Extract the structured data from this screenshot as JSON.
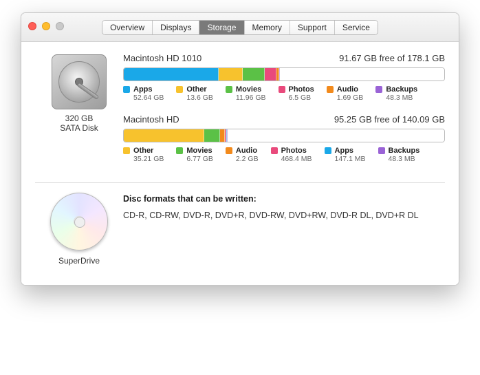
{
  "tabs": {
    "overview": "Overview",
    "displays": "Displays",
    "storage": "Storage",
    "memory": "Memory",
    "support": "Support",
    "service": "Service"
  },
  "drive": {
    "size_label": "320 GB",
    "type_label": "SATA Disk"
  },
  "colors": {
    "apps": "#1aa8e8",
    "other": "#f7c22d",
    "movies": "#5bc146",
    "photos": "#e94a7c",
    "audio": "#f28a1c",
    "backups": "#9a63d6",
    "free": "#ffffff"
  },
  "volumes": [
    {
      "name": "Macintosh HD 1010",
      "free_text": "91.67 GB free of 178.1 GB",
      "total_gb": 178.1,
      "segments": [
        {
          "key": "apps",
          "label": "Apps",
          "value": "52.64 GB",
          "gb": 52.64
        },
        {
          "key": "other",
          "label": "Other",
          "value": "13.6 GB",
          "gb": 13.6
        },
        {
          "key": "movies",
          "label": "Movies",
          "value": "11.96 GB",
          "gb": 11.96
        },
        {
          "key": "photos",
          "label": "Photos",
          "value": "6.5 GB",
          "gb": 6.5
        },
        {
          "key": "audio",
          "label": "Audio",
          "value": "1.69 GB",
          "gb": 1.69
        },
        {
          "key": "backups",
          "label": "Backups",
          "value": "48.3 MB",
          "gb": 0.05
        }
      ]
    },
    {
      "name": "Macintosh HD",
      "free_text": "95.25 GB free of 140.09 GB",
      "total_gb": 140.09,
      "segments": [
        {
          "key": "other",
          "label": "Other",
          "value": "35.21 GB",
          "gb": 35.21
        },
        {
          "key": "movies",
          "label": "Movies",
          "value": "6.77 GB",
          "gb": 6.77
        },
        {
          "key": "audio",
          "label": "Audio",
          "value": "2.2 GB",
          "gb": 2.2
        },
        {
          "key": "photos",
          "label": "Photos",
          "value": "468.4 MB",
          "gb": 0.47
        },
        {
          "key": "apps",
          "label": "Apps",
          "value": "147.1 MB",
          "gb": 0.15
        },
        {
          "key": "backups",
          "label": "Backups",
          "value": "48.3 MB",
          "gb": 0.05
        }
      ]
    }
  ],
  "superdrive": {
    "name": "SuperDrive",
    "formats_title": "Disc formats that can be written:",
    "formats": "CD-R, CD-RW, DVD-R, DVD+R, DVD-RW, DVD+RW, DVD-R DL, DVD+R DL"
  }
}
